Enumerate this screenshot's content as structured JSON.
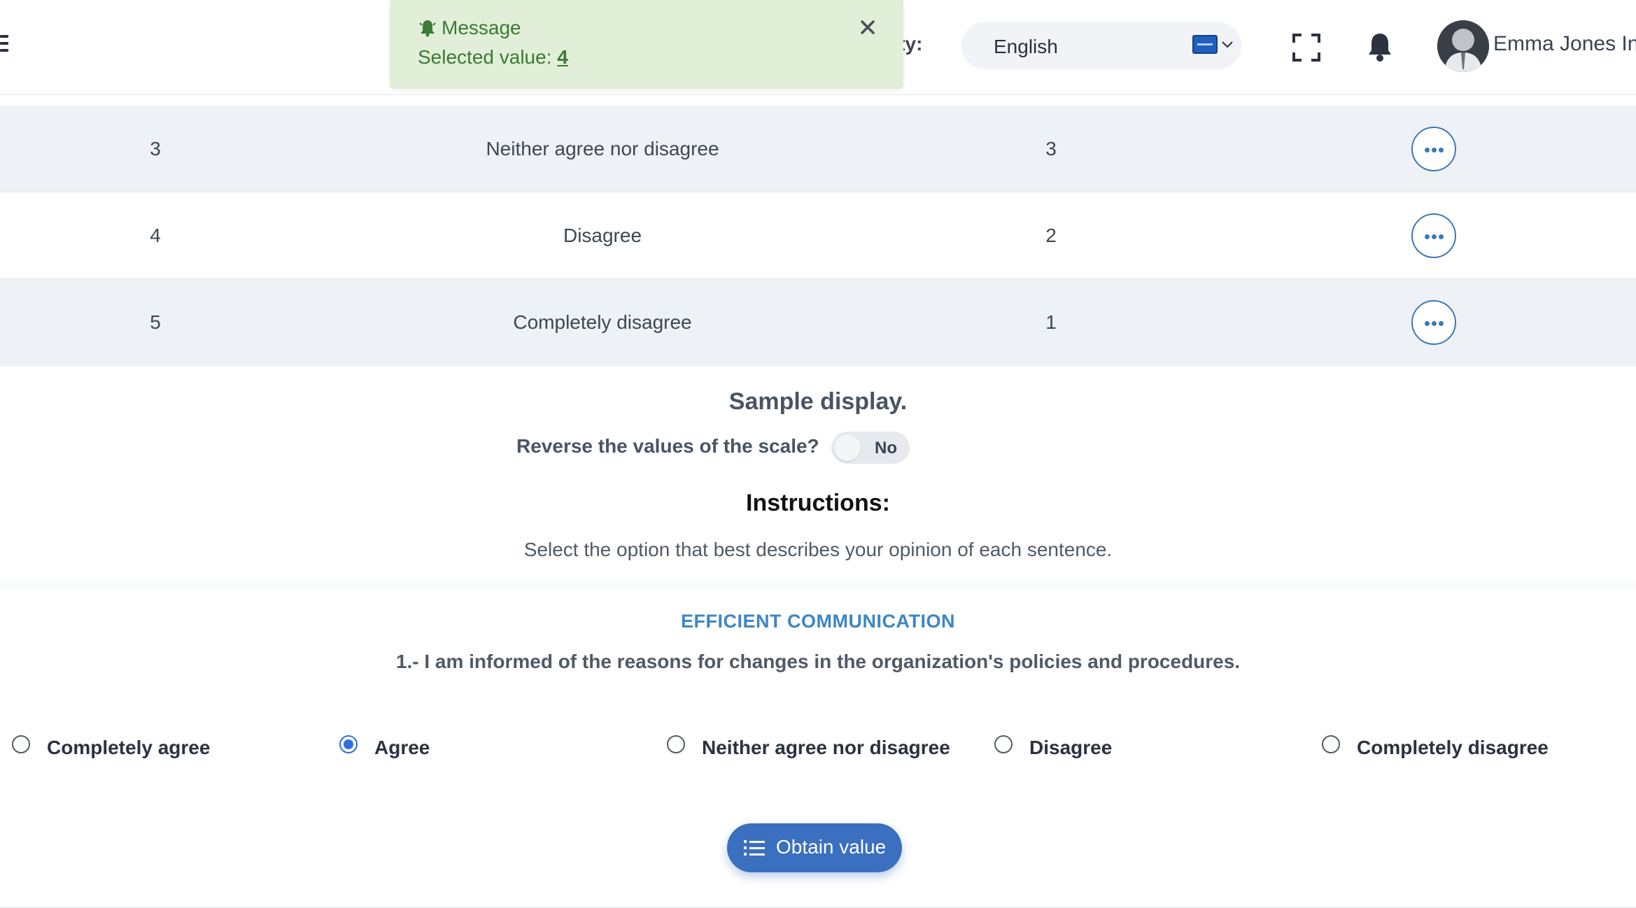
{
  "header": {
    "entity_label": "ntity:",
    "language": "English",
    "flag_icon": "flag-icon",
    "user_name": "Emma Jones Ing"
  },
  "toast": {
    "title": "Message",
    "body_prefix": "Selected value: ",
    "value": "4",
    "color": "#3c7a35",
    "background": "#e1efd8"
  },
  "table": {
    "rows": [
      {
        "index": "3",
        "label": "Neither agree nor disagree",
        "value": "3"
      },
      {
        "index": "4",
        "label": "Disagree",
        "value": "2"
      },
      {
        "index": "5",
        "label": "Completely disagree",
        "value": "1"
      }
    ]
  },
  "sample": {
    "title": "Sample display.",
    "reverse_label": "Reverse the values of the scale?",
    "toggle_text": "No"
  },
  "instructions": {
    "title": "Instructions:",
    "text": "Select the option that best describes your opinion of each sentence."
  },
  "section": {
    "title": "EFFICIENT COMMUNICATION",
    "question": "1.- I am informed of the reasons for changes in the organization's policies and procedures."
  },
  "options": [
    {
      "label": "Completely agree",
      "selected": false
    },
    {
      "label": "Agree",
      "selected": true
    },
    {
      "label": "Neither agree nor disagree",
      "selected": false
    },
    {
      "label": "Disagree",
      "selected": false
    },
    {
      "label": "Completely disagree",
      "selected": false
    }
  ],
  "obtain_button": {
    "label": "Obtain value"
  },
  "colors": {
    "accent": "#3b6fbf",
    "section_title": "#3c86c6",
    "radio_selected": "#2f6fe0"
  }
}
